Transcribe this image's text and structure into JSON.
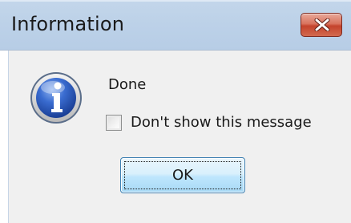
{
  "window": {
    "title": "Information"
  },
  "titlebar": {
    "close_icon": "close-icon"
  },
  "dialog": {
    "icon": "info-icon",
    "message": "Done",
    "checkbox_label": "Don't show this message",
    "checkbox_checked": false,
    "ok_label": "OK"
  },
  "colors": {
    "titlebar": "#bcd1e8",
    "client_bg": "#f0f0f0",
    "close_button": "#c4432c",
    "ok_button": "#bee6fd",
    "info_icon": "#2c57b8"
  }
}
